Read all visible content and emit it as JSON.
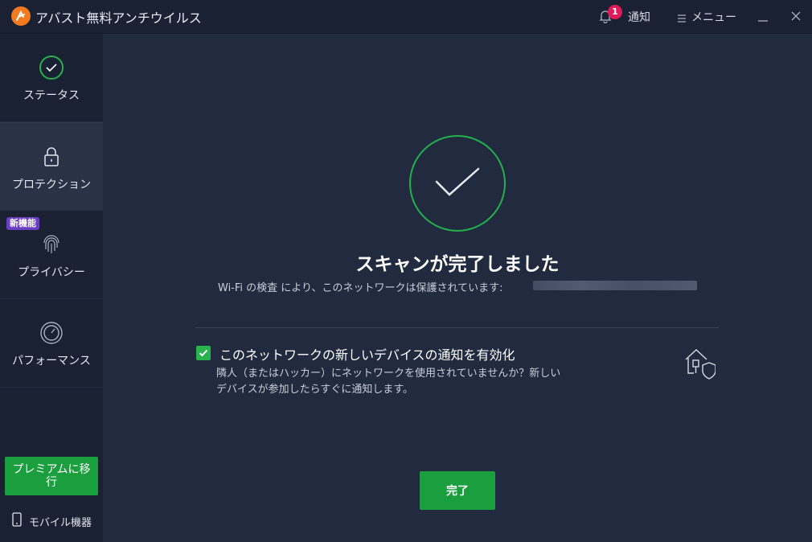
{
  "app": {
    "title": "アバスト無料アンチウイルス",
    "brand_color": "#f47a20"
  },
  "titlebar": {
    "notification_count": "1",
    "notification_label": "通知",
    "menu_label": "メニュー"
  },
  "sidebar": {
    "items": [
      {
        "label": "ステータス",
        "icon": "check-circle-icon",
        "active": false
      },
      {
        "label": "プロテクション",
        "icon": "lock-icon",
        "active": true
      },
      {
        "label": "プライバシー",
        "icon": "fingerprint-icon",
        "active": false,
        "badge": "新機能"
      },
      {
        "label": "パフォーマンス",
        "icon": "speedometer-icon",
        "active": false
      }
    ],
    "premium_button": "プレミアムに移行",
    "mobile_label": "モバイル機器"
  },
  "main": {
    "headline": "スキャンが完了しました",
    "subline": "Wi-Fi の検査 により、このネットワークは保護されています:",
    "option": {
      "checked": true,
      "title": "このネットワークの新しいデバイスの通知を有効化",
      "description": "隣人（またはハッカー）にネットワークを使用されていませんか？新しいデバイスが参加したらすぐに通知します。"
    },
    "done_button": "完了"
  },
  "colors": {
    "accent_green": "#1b9e3e",
    "success_green": "#23b14d",
    "badge_red": "#e01b59",
    "badge_purple": "#6a3fc3",
    "background": "#212a3f",
    "sidebar": "#1a2133"
  }
}
